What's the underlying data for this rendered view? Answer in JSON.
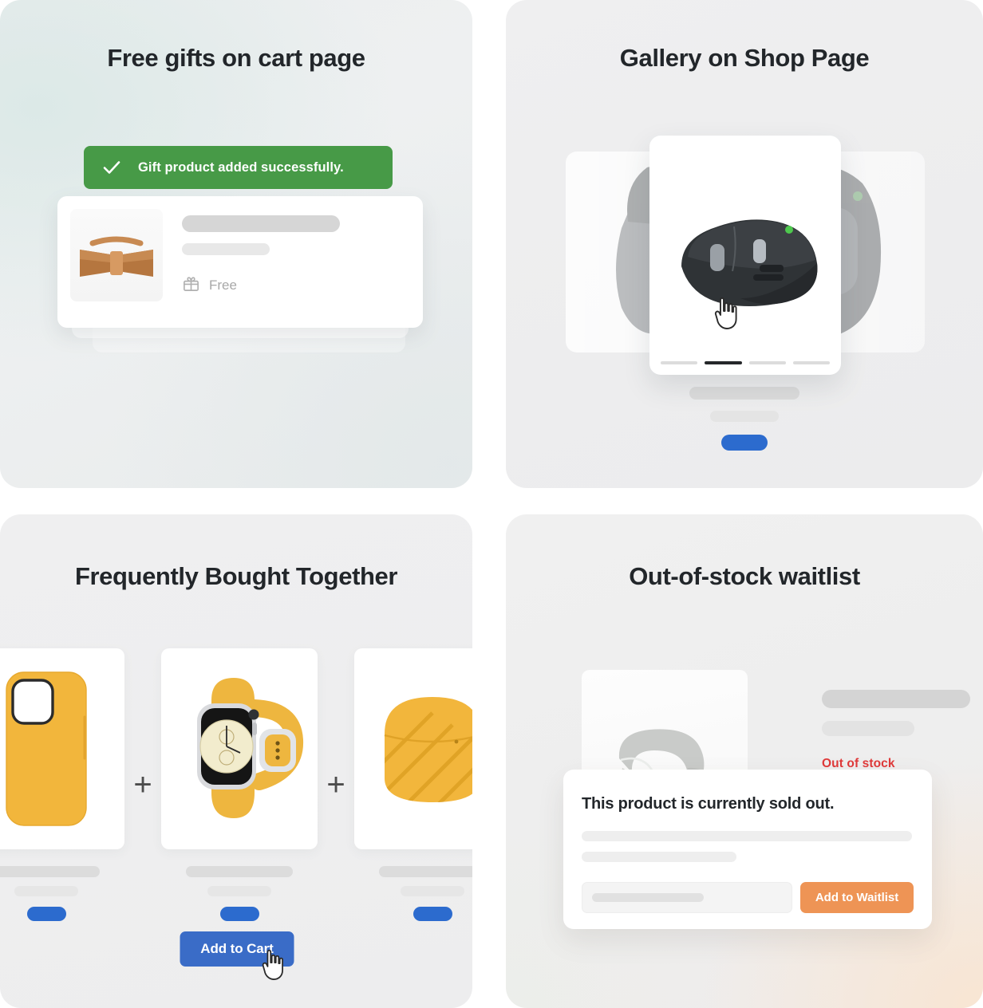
{
  "cards": [
    {
      "id": "free-gifts",
      "title": "Free gifts on cart page",
      "toast": {
        "message": "Gift product added successfully.",
        "icon": "check-icon",
        "color": "#479a47"
      },
      "gift_item": {
        "price_label": "Free",
        "icon": "gift-icon",
        "thumb_alt": "wooden-bow-tie"
      }
    },
    {
      "id": "gallery-shop",
      "title": "Gallery on Shop Page",
      "gallery": {
        "slide_count": 4,
        "active_slide": 2,
        "cursor": "pointer-hand-cursor",
        "image_alt": "wireless-mouse"
      },
      "button_color": "#2c6bce"
    },
    {
      "id": "frequently-bought",
      "title": "Frequently Bought Together",
      "plus_symbol": "+",
      "items": [
        {
          "alt": "yellow-phone-case"
        },
        {
          "alt": "yellow-smart-watch"
        },
        {
          "alt": "yellow-earbuds-case"
        }
      ],
      "cta_label": "Add to Cart",
      "cta_color": "#3a6cc7",
      "cursor": "pointer-hand-cursor"
    },
    {
      "id": "out-of-stock-waitlist",
      "title": "Out-of-stock waitlist",
      "product": {
        "alt": "grey-armchair",
        "status_label": "Out of stock",
        "status_color": "#e03a3a"
      },
      "panel": {
        "heading": "This product is currently sold out.",
        "cta_label": "Add to Waitlist",
        "cta_color": "#ee9455",
        "input_placeholder": ""
      }
    }
  ]
}
